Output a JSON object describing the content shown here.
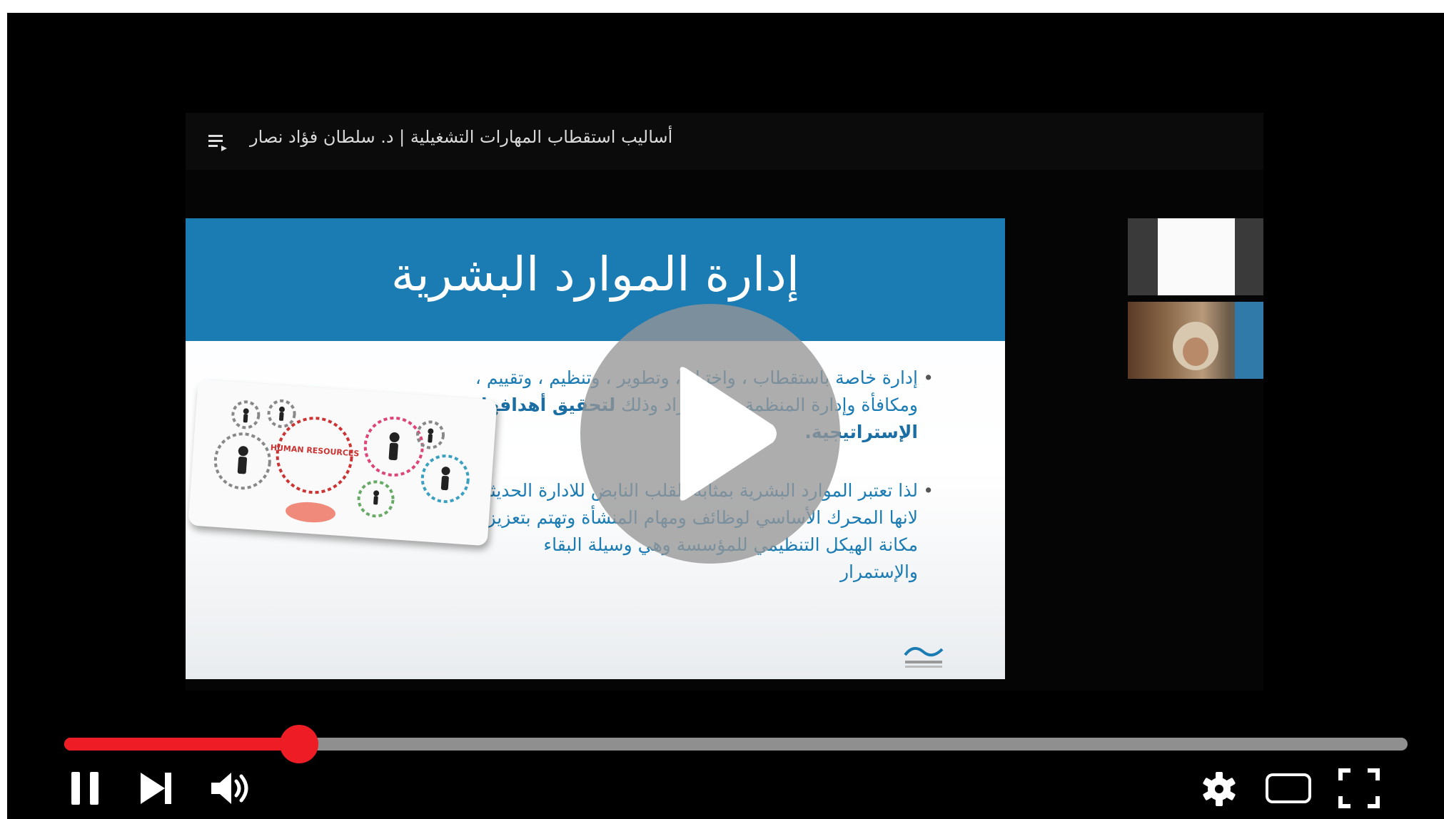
{
  "video": {
    "title": "أساليب استقطاب المهارات التشغيلية | د. سلطان فؤاد نصار"
  },
  "slide": {
    "title": "إدارة الموارد البشرية",
    "bullet1_text": "إدارة خاصة باستقطاب ، واختيار ، وتطوير ، وتنظيم ، وتقييم ، ومكافأة وإدارة المنظمة من الأفراد وذلك ",
    "bullet1_bold": "لتحقيق أهدافها الإستراتيجية.",
    "bullet2_text": "لذا تعتبر الموارد البشرية بمثابة القلب النابض للادارة الحديثة لانها المحرك الأساسي لوظائف ومهام المنشأة وتهتم بتعزيز مكانة الهيكل التنظيمي للمؤسسة وهي وسيلة البقاء والإستمرار",
    "image_label": "HUMAN RESOURCES"
  },
  "player": {
    "progress_fraction": 0.175,
    "accent_color": "#ee1d25",
    "icons": [
      "playlist-icon",
      "play-icon",
      "pause-icon",
      "next-icon",
      "volume-icon",
      "settings-icon",
      "theater-icon",
      "fullscreen-icon"
    ]
  }
}
